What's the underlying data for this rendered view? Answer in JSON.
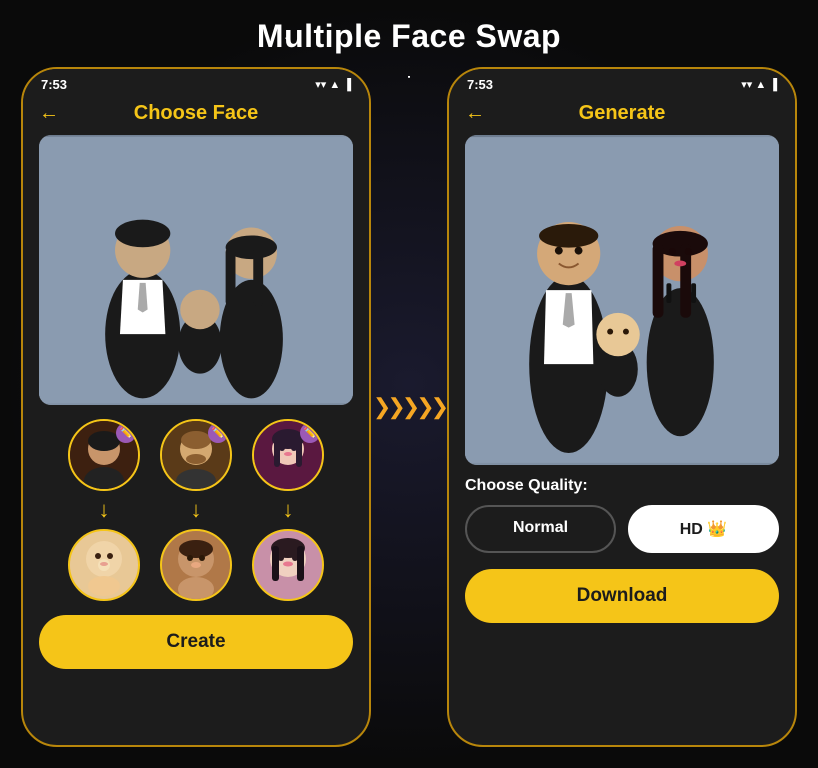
{
  "page": {
    "title": "Multiple Face Swap",
    "background": "#0a0a0a"
  },
  "arrow_divider": {
    "symbol": "❯❯❯❯❯"
  },
  "left_phone": {
    "status_time": "7:53",
    "back_label": "←",
    "header_title": "Choose Face",
    "create_button_label": "Create",
    "faces": [
      {
        "id": "neymar",
        "type": "source",
        "emoji": "👦🏾"
      },
      {
        "id": "messi",
        "type": "source",
        "emoji": "🧔"
      },
      {
        "id": "girl",
        "type": "source",
        "emoji": "👧🏻"
      }
    ],
    "targets": [
      {
        "id": "baby",
        "type": "target",
        "emoji": "👶"
      },
      {
        "id": "man",
        "type": "target",
        "emoji": "😊"
      },
      {
        "id": "woman",
        "type": "target",
        "emoji": "😊"
      }
    ]
  },
  "right_phone": {
    "status_time": "7:53",
    "back_label": "←",
    "header_title": "Generate",
    "quality_label": "Choose Quality:",
    "quality_normal_label": "Normal",
    "quality_hd_label": "HD 👑",
    "download_button_label": "Download"
  }
}
